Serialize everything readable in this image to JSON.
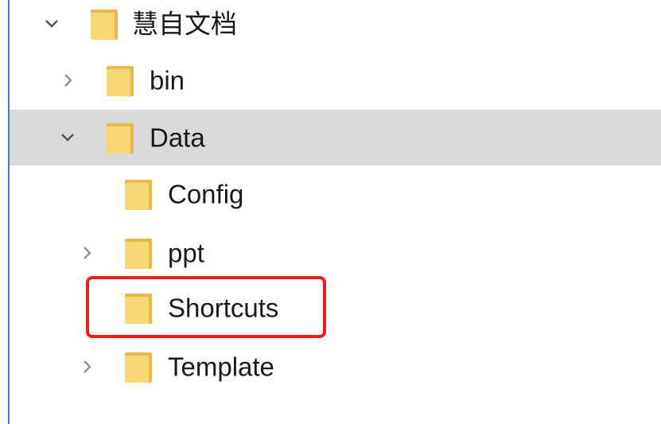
{
  "tree": {
    "items": [
      {
        "label": "慧自文档",
        "chevron": "expanded",
        "icon": "folder-icon"
      },
      {
        "label": "bin",
        "chevron": "collapsed",
        "icon": "folder-icon"
      },
      {
        "label": "Data",
        "chevron": "expanded",
        "icon": "folder-icon",
        "selected": true
      },
      {
        "label": "Config",
        "chevron": "none",
        "icon": "folder-icon"
      },
      {
        "label": "ppt",
        "chevron": "collapsed",
        "icon": "folder-icon"
      },
      {
        "label": "Shortcuts",
        "chevron": "none",
        "icon": "folder-icon",
        "highlighted": true
      },
      {
        "label": "Template",
        "chevron": "collapsed",
        "icon": "folder-icon"
      }
    ]
  },
  "colors": {
    "selection_bg": "#d9d9d9",
    "highlight_border": "#e8211d",
    "folder_fill": "#f8d775",
    "folder_back": "#e6b94a",
    "window_border": "#3b7fd6"
  }
}
